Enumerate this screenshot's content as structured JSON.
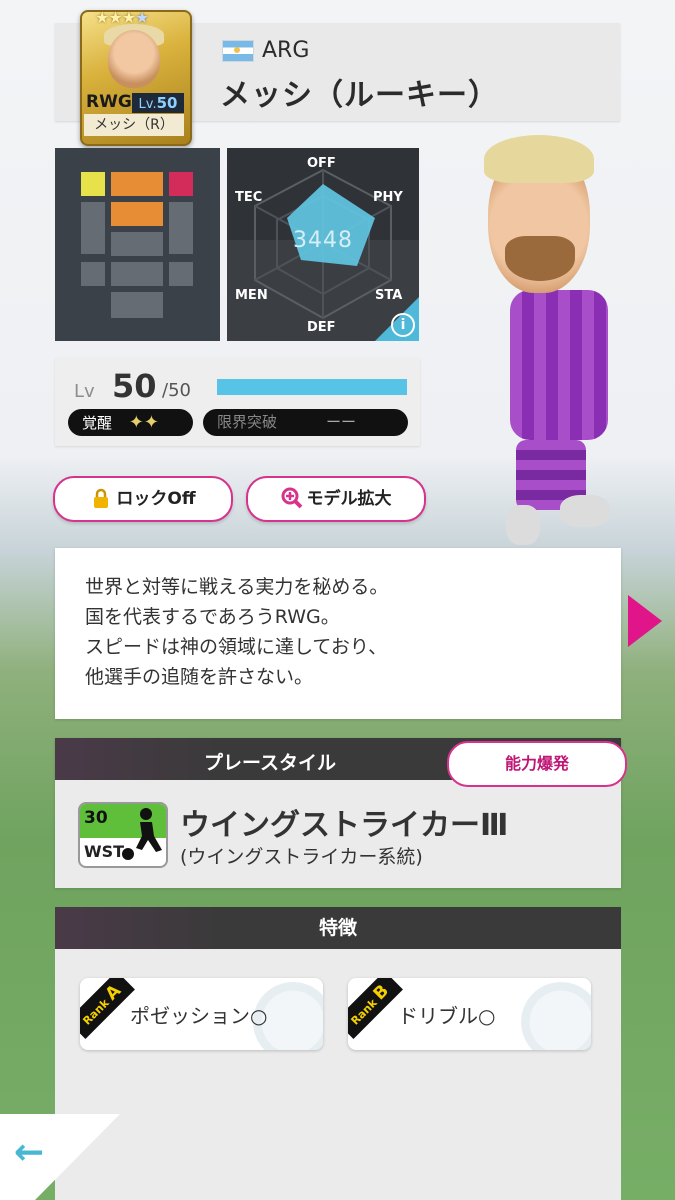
{
  "player": {
    "country": "ARG",
    "name": "メッシ（ルーキー）",
    "card": {
      "stars": "★★★",
      "star_dim": "★",
      "position": "RWG",
      "lv_prefix": "Lv.",
      "lv": "50",
      "name": "メッシ（R）"
    }
  },
  "radar": {
    "labels": {
      "off": "OFF",
      "tec": "TEC",
      "phy": "PHY",
      "men": "MEN",
      "sta": "STA",
      "def": "DEF"
    },
    "score": "3448",
    "info_icon": "info-icon"
  },
  "level": {
    "label": "Lv",
    "value": "50",
    "max": "/50",
    "progress": 1.0,
    "awakening_label": "覚醒",
    "awakening_stars": "✦✦",
    "limit_break_label": "限界突破",
    "limit_break_value": "ーー"
  },
  "buttons": {
    "lock": "ロックOff",
    "model_zoom": "モデル拡大",
    "ability": "能力爆発"
  },
  "description": [
    "世界と対等に戦える実力を秘める。",
    "国を代表するであろうRWG。",
    "スピードは神の領域に達しており、",
    "他選手の追随を許さない。"
  ],
  "playstyle": {
    "header": "プレースタイル",
    "level": "30",
    "tag": "WST",
    "name": "ウイングストライカーⅢ",
    "sub": "(ウイングストライカー系統)"
  },
  "features": {
    "header": "特徴",
    "items": [
      {
        "rank_prefix": "Rank",
        "rank": "A",
        "label": "ポゼッション○"
      },
      {
        "rank_prefix": "Rank",
        "rank": "B",
        "label": "ドリブル○"
      }
    ]
  },
  "colors": {
    "accent": "#d6338f",
    "cyan": "#57c3e6",
    "dark": "#3a3a3a"
  },
  "icons": {
    "lock": "lock-icon",
    "zoom": "zoom-plus-icon",
    "back": "back-arrow-icon",
    "next": "next-arrow-icon"
  }
}
